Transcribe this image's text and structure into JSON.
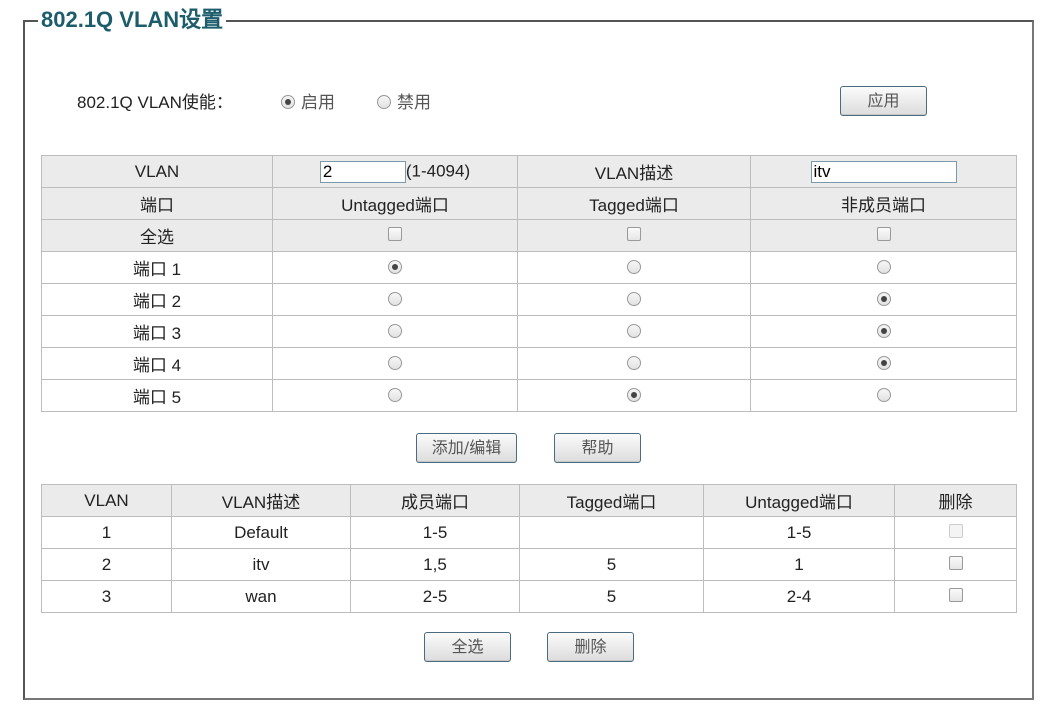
{
  "section_title": "802.1Q VLAN设置",
  "enable": {
    "label": "802.1Q VLAN使能：",
    "option_on": "启用",
    "option_off": "禁用",
    "selected": "启用"
  },
  "apply_button": "应用",
  "vlan_form": {
    "vlan_label": "VLAN",
    "vlan_id_value": "2",
    "vlan_id_range": "(1-4094)",
    "desc_label": "VLAN描述",
    "desc_value": "itv",
    "col_port": "端口",
    "col_untagged": "Untagged端口",
    "col_tagged": "Tagged端口",
    "col_nonmember": "非成员端口",
    "select_all_label": "全选",
    "ports": [
      {
        "name": "端口 1",
        "mode": "untagged"
      },
      {
        "name": "端口 2",
        "mode": "nonmember"
      },
      {
        "name": "端口 3",
        "mode": "nonmember"
      },
      {
        "name": "端口 4",
        "mode": "nonmember"
      },
      {
        "name": "端口 5",
        "mode": "tagged"
      }
    ]
  },
  "add_edit_button": "添加/编辑",
  "help_button": "帮助",
  "vlan_list": {
    "headers": [
      "VLAN",
      "VLAN描述",
      "成员端口",
      "Tagged端口",
      "Untagged端口",
      "删除"
    ],
    "rows": [
      {
        "vlan": "1",
        "desc": "Default",
        "members": "1-5",
        "tagged": "",
        "untagged": "1-5",
        "deletable": false
      },
      {
        "vlan": "2",
        "desc": "itv",
        "members": "1,5",
        "tagged": "5",
        "untagged": "1",
        "deletable": true
      },
      {
        "vlan": "3",
        "desc": "wan",
        "members": "2-5",
        "tagged": "5",
        "untagged": "2-4",
        "deletable": true
      }
    ]
  },
  "select_all_button": "全选",
  "delete_button": "删除"
}
